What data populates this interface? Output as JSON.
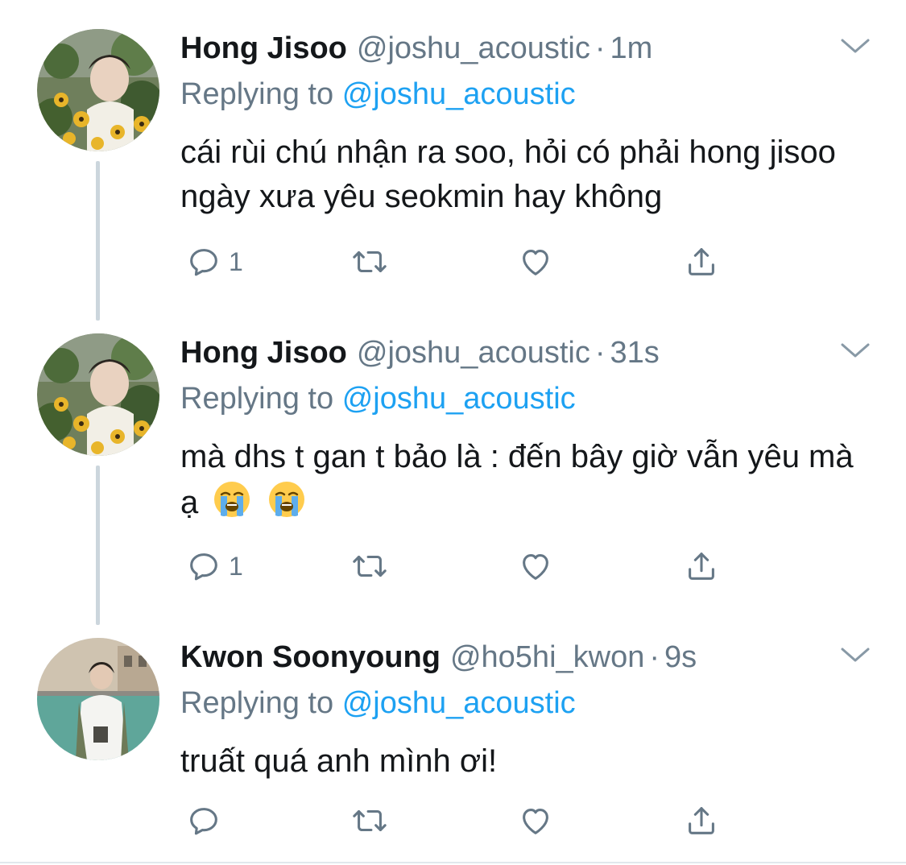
{
  "tweets": [
    {
      "name": "Hong Jisoo",
      "handle": "@joshu_acoustic",
      "separator": "·",
      "time": "1m",
      "replying_prefix": "Replying to",
      "replying_to": "@joshu_acoustic",
      "text": "cái rùi chú nhận ra soo, hỏi có phải hong jisoo ngày xưa yêu seokmin hay không",
      "reply_count": "1",
      "avatar": "flowers-portrait"
    },
    {
      "name": "Hong Jisoo",
      "handle": "@joshu_acoustic",
      "separator": "·",
      "time": "31s",
      "replying_prefix": "Replying to",
      "replying_to": "@joshu_acoustic",
      "text": "mà dhs t gan t bảo là : đến bây giờ vẫn yêu mà ạ",
      "emoji": [
        "loudly-crying-face",
        "loudly-crying-face"
      ],
      "reply_count": "1",
      "avatar": "flowers-portrait"
    },
    {
      "name": "Kwon Soonyoung",
      "handle": "@ho5hi_kwon",
      "separator": "·",
      "time": "9s",
      "replying_prefix": "Replying to",
      "replying_to": "@joshu_acoustic",
      "text": "truất quá anh mình ơi!",
      "reply_count": "",
      "avatar": "canal-portrait"
    }
  ],
  "icons": [
    "reply-icon",
    "retweet-icon",
    "like-icon",
    "share-icon",
    "chevron-down-icon"
  ],
  "colors": {
    "accent": "#1da1f2",
    "secondary": "#657786",
    "text": "#14171a",
    "thread_line": "#ccd6dd"
  }
}
